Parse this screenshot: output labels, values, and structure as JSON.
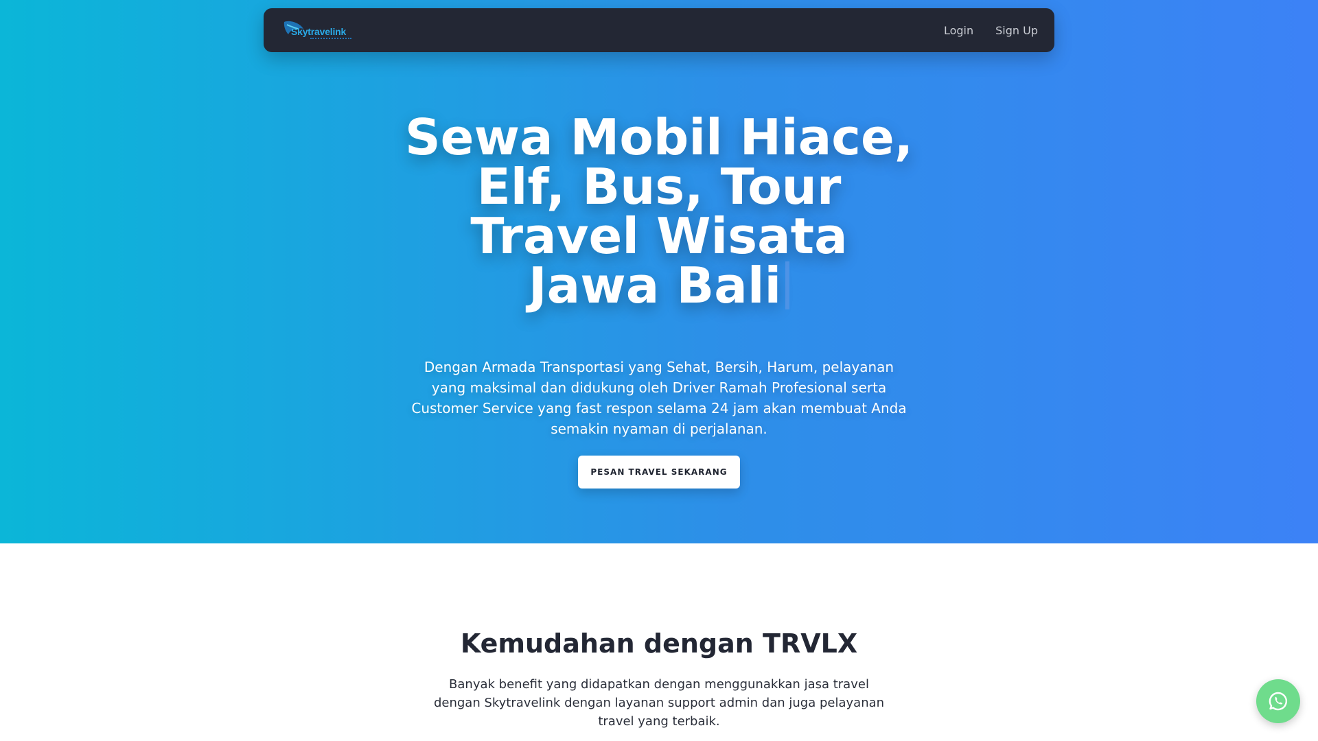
{
  "navbar": {
    "logo_text": "Skytravelink",
    "links": [
      {
        "label": "Login"
      },
      {
        "label": "Sign Up"
      }
    ]
  },
  "hero": {
    "title_lines": [
      "Sewa Mobil Hiace,",
      "Elf, Bus, Tour",
      "Travel Wisata",
      "Jawa Bali"
    ],
    "description": "Dengan Armada Transportasi yang Sehat, Bersih, Harum, pelayanan yang maksimal dan didukung oleh Driver Ramah Profesional serta Customer Service yang fast respon selama 24 jam akan membuat Anda semakin nyaman di perjalanan.",
    "cta_label": "PESAN TRAVEL SEKARANG"
  },
  "features": {
    "title": "Kemudahan dengan TRVLX",
    "description": "Banyak benefit yang didapatkan dengan menggunakkan jasa travel dengan Skytravelink dengan layanan support admin dan juga pelayanan travel yang terbaik."
  },
  "floating": {
    "whatsapp_icon": "whatsapp-icon"
  },
  "colors": {
    "gradient_start": "#0bb6d8",
    "gradient_end": "#3c82f6",
    "navbar_bg": "#232734",
    "logo_accent": "#2aa9e6",
    "whatsapp": "#6fdc8c"
  }
}
